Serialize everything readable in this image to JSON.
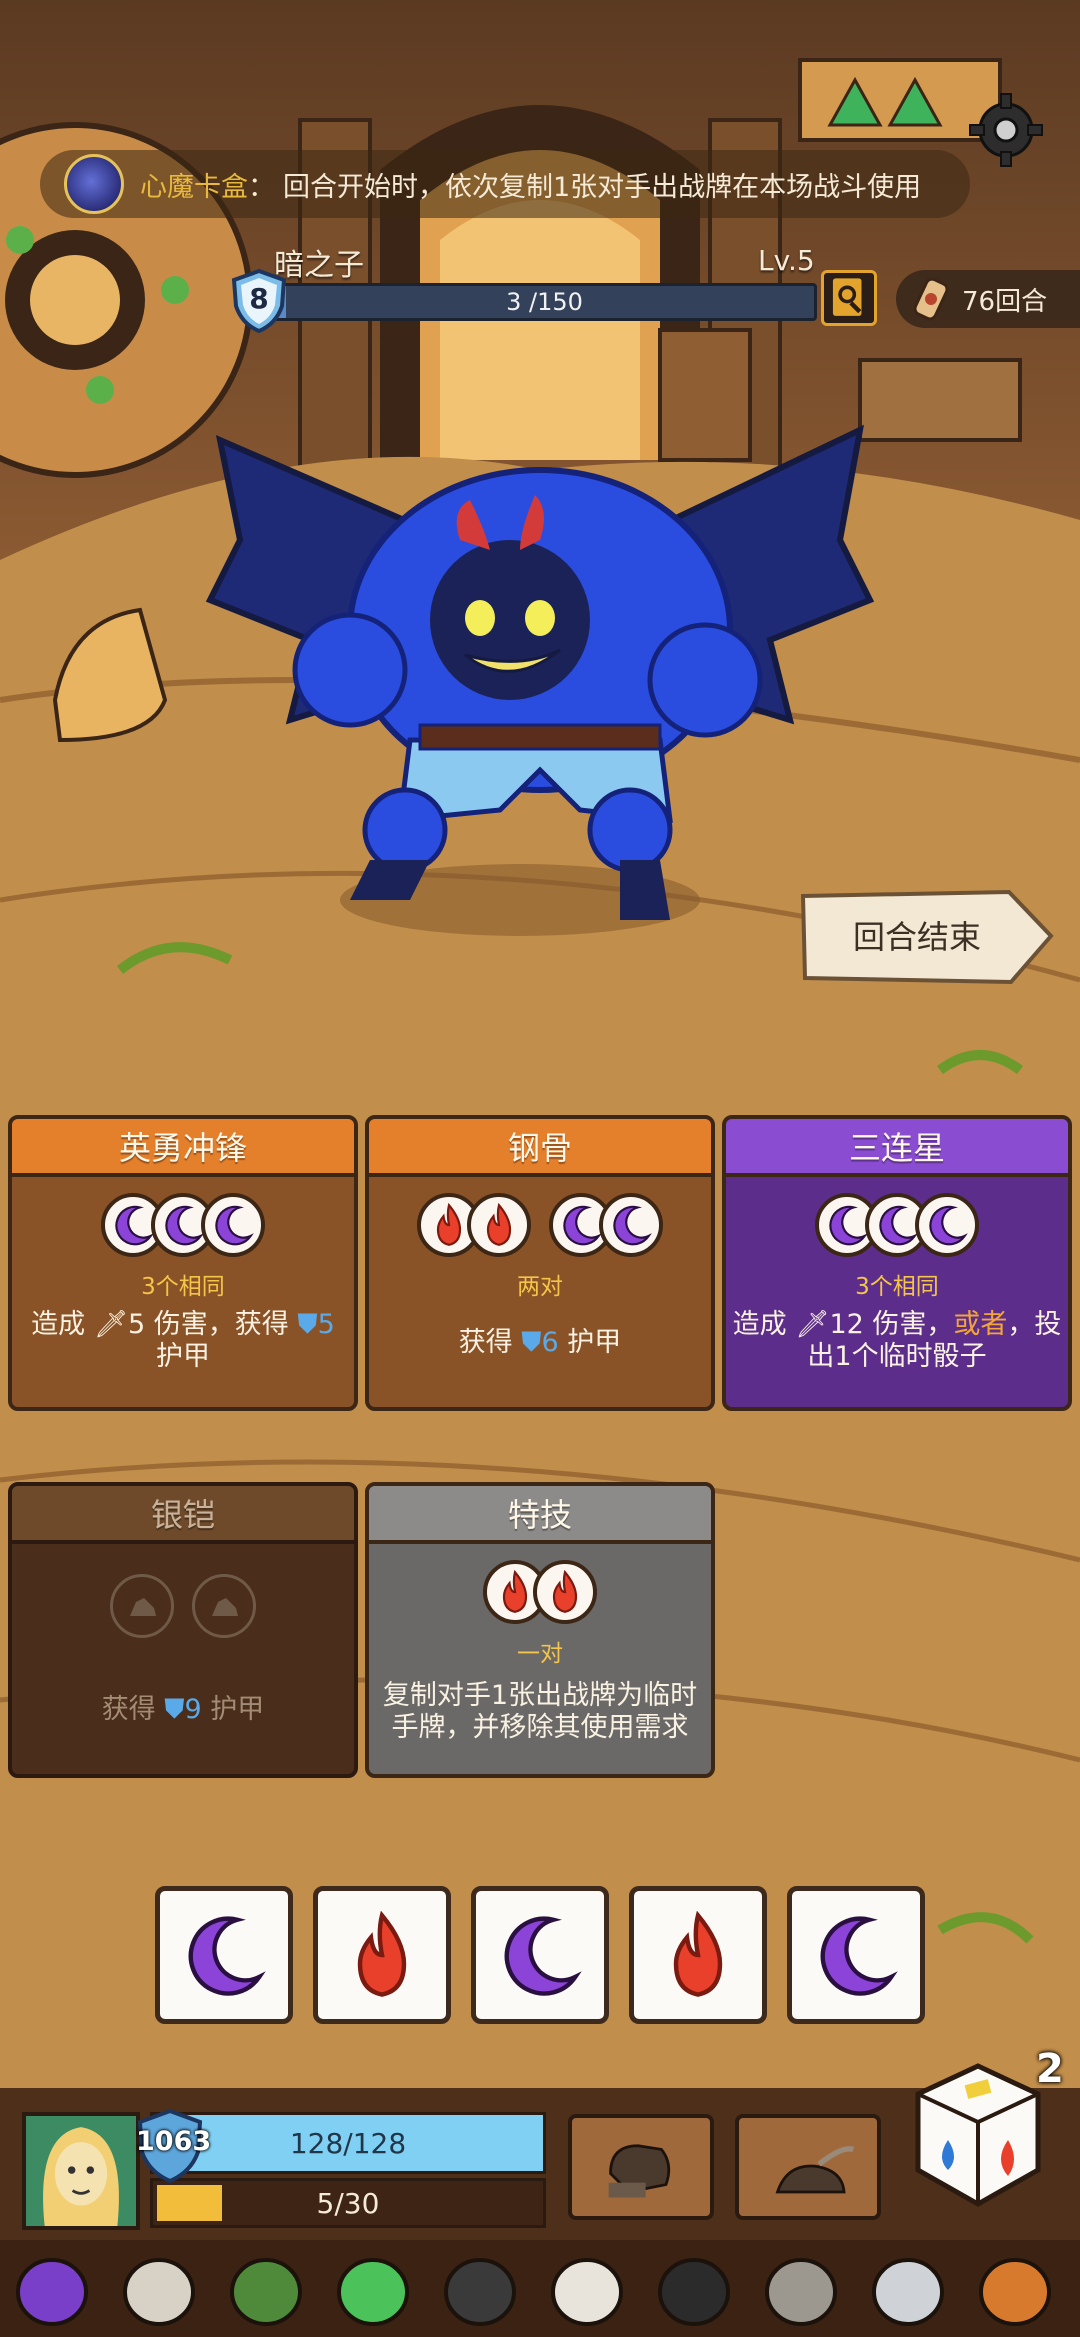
{
  "buff": {
    "name": "心魔卡盒",
    "colon": "：",
    "description": "回合开始时，依次复制1张对手出战牌在本场战斗使用",
    "icon": "moon-face-icon"
  },
  "enemy": {
    "name": "暗之子",
    "level": "Lv.5",
    "hp_text": "3 /150",
    "hp_current": 3,
    "hp_max": 150,
    "shield": "8"
  },
  "round": {
    "label": "76回合"
  },
  "end_turn": {
    "label": "回合结束"
  },
  "cards": [
    {
      "title": "英勇冲锋",
      "style": "orange",
      "slot_groups": [
        [
          "moon",
          "moon",
          "moon"
        ]
      ],
      "condition": "3个相同",
      "effect_parts": [
        "造成 ",
        "🗡5",
        " 伤害，获得 ",
        "⛊5",
        "护甲"
      ]
    },
    {
      "title": "钢骨",
      "style": "orange",
      "slot_groups": [
        [
          "fire",
          "fire"
        ],
        [
          "moon",
          "moon"
        ]
      ],
      "condition": "两对",
      "effect_parts": [
        "获得 ",
        "⛊6",
        " 护甲"
      ]
    },
    {
      "title": "三连星",
      "style": "purple",
      "slot_groups": [
        [
          "moon",
          "moon",
          "moon"
        ]
      ],
      "condition": "3个相同",
      "effect_parts": [
        "造成 ",
        "🗡12",
        " 伤害，",
        "或者",
        "，投出1个临时骰子"
      ]
    },
    {
      "title": "银铠",
      "style": "dark",
      "slot_groups": [
        [
          "empty"
        ],
        [
          "empty"
        ]
      ],
      "condition": "",
      "effect_parts": [
        "获得 ",
        "⛊9",
        " 护甲"
      ]
    },
    {
      "title": "特技",
      "style": "grey",
      "slot_groups": [
        [
          "fire",
          "fire"
        ]
      ],
      "condition": "一对",
      "effect_parts": [
        "复制对手1张出战牌为临时手牌，并移除其使用需求"
      ]
    }
  ],
  "dice": [
    "moon",
    "fire",
    "moon",
    "fire",
    "moon"
  ],
  "dice_remaining": "2",
  "player": {
    "armor": "1063",
    "hp_text": "128/128",
    "hp_fraction": 1.0,
    "xp_text": "5/30",
    "xp_fraction": 0.167
  },
  "relics": [
    "purple-weapon-icon",
    "skull-book-icon",
    "turtle-shell-icon",
    "green-gem-icon",
    "iron-collar-icon",
    "ghost-icon",
    "black-bib-icon",
    "stone-tablet-icon",
    "d20-icon",
    "ham-icon"
  ],
  "colors": {
    "moon": "#8c44d8",
    "fire": "#e8402a",
    "orange_header": "#e47f2b",
    "purple_header": "#8a4cd1"
  }
}
